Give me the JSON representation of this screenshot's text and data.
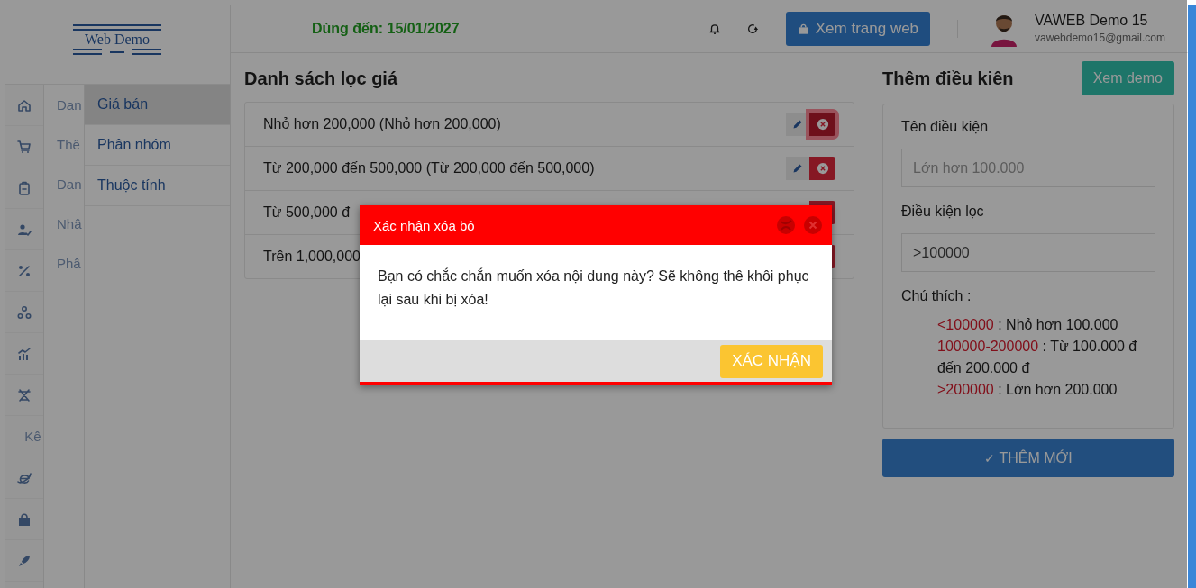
{
  "logo": {
    "text": "Web Demo"
  },
  "nav_items": [
    {
      "kind": "icon",
      "label": "Dan"
    },
    {
      "kind": "icon",
      "label": "Thê"
    },
    {
      "kind": "icon",
      "label": "Dan"
    },
    {
      "kind": "icon",
      "label": "Nhâ"
    },
    {
      "kind": "icon",
      "label": "Phâ"
    },
    {
      "kind": "icon"
    },
    {
      "kind": "icon"
    },
    {
      "kind": "icon"
    },
    {
      "kind": "text",
      "label": "Kê"
    },
    {
      "kind": "icon"
    },
    {
      "kind": "icon"
    },
    {
      "kind": "icon"
    }
  ],
  "submenu": [
    {
      "label": "Giá bán",
      "selected": true
    },
    {
      "label": "Phân nhóm",
      "selected": false
    },
    {
      "label": "Thuộc tính",
      "selected": false
    }
  ],
  "header": {
    "expiry": "Dùng đến: 15/01/2027",
    "site_button": "Xem trang web",
    "user_name": "VAWEB Demo 15",
    "user_email": "vawebdemo15@gmail.com"
  },
  "price_list": {
    "title": "Danh sách lọc giá",
    "rows": [
      {
        "kind": "full",
        "label": "Nhỏ hơn 200,000 (Nhỏ hơn 200,000)",
        "focused": true
      },
      {
        "kind": "full",
        "label": "Từ 200,000 đến 500,000 (Từ 200,000 đến 500,000)",
        "focused": false
      },
      {
        "kind": "covered",
        "label": "Từ 500,000 đ"
      },
      {
        "kind": "covered",
        "label": "Trên 1,000,000"
      }
    ]
  },
  "add_form": {
    "title": "Thêm điều kiên",
    "demo_button": "Xem demo",
    "fields": [
      {
        "label": "Tên điều kiện",
        "placeholder": "Lớn hơn 100.000"
      },
      {
        "label": "Điều kiện lọc",
        "value": ">100000"
      }
    ],
    "legend_title": "Chú thích :",
    "legend": [
      {
        "code": "<100000",
        "text": " : Nhỏ hơn 100.000"
      },
      {
        "code": "100000-200000",
        "text": " : Từ 100.000 đ đến 200.000 đ"
      },
      {
        "code": ">200000",
        "text": " : Lớn hơn 200.000"
      }
    ],
    "submit_icon": "✓",
    "submit_button": "THÊM MỚI"
  },
  "dialog": {
    "title": "Xác nhận xóa bỏ",
    "message": "Bạn có chắc chắn muốn xóa nội dung này? Sẽ không thê khôi phục lại sau khi bị xóa!",
    "confirm_button": "XÁC NHẬN"
  }
}
